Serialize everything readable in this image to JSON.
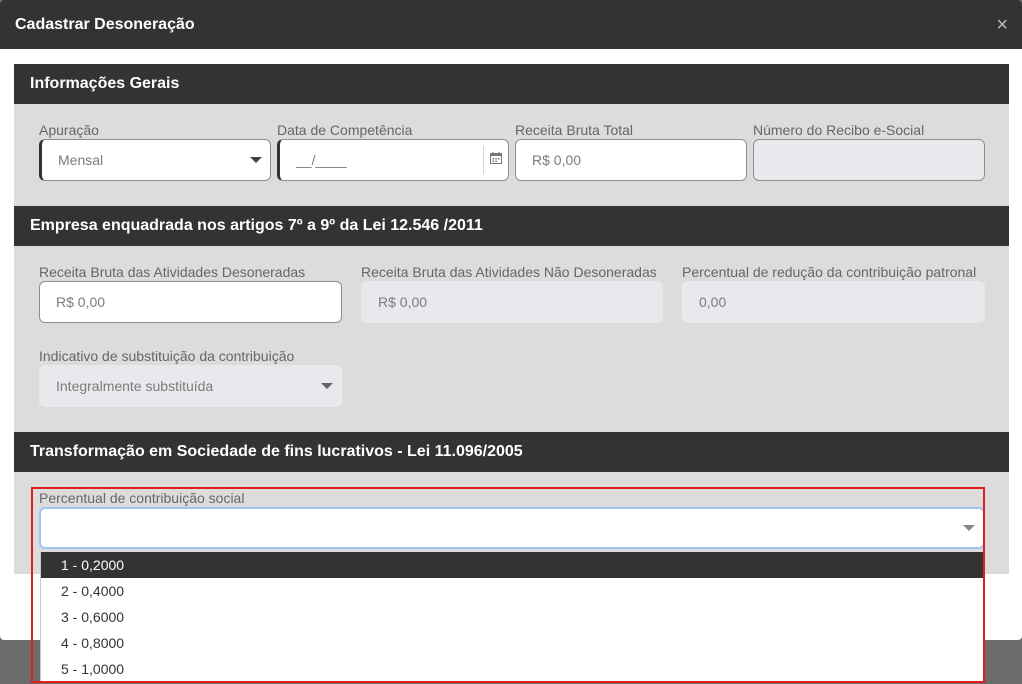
{
  "modal": {
    "title": "Cadastrar Desoneração",
    "close_label": "×"
  },
  "section1": {
    "title": "Informações Gerais",
    "apuracao": {
      "label": "Apuração",
      "value": "Mensal"
    },
    "data_competencia": {
      "label": "Data de Competência",
      "value": "__/____"
    },
    "receita_bruta_total": {
      "label": "Receita Bruta Total",
      "value": "R$ 0,00"
    },
    "numero_recibo": {
      "label": "Número do Recibo e-Social",
      "value": ""
    }
  },
  "section2": {
    "title": "Empresa enquadrada nos artigos 7º a 9º da Lei 12.546 /2011",
    "receita_desoneradas": {
      "label": "Receita Bruta das Atividades Desoneradas",
      "value": "R$ 0,00"
    },
    "receita_nao_desoneradas": {
      "label": "Receita Bruta das Atividades Não Desoneradas",
      "value": "R$ 0,00"
    },
    "percentual_reducao": {
      "label": "Percentual de redução da contribuição patronal",
      "value": "0,00"
    },
    "indicativo": {
      "label": "Indicativo de substituição da contribuição",
      "value": "Integralmente substituída"
    }
  },
  "section3": {
    "title": "Transformação em Sociedade de fins lucrativos - Lei 11.096/2005",
    "percentual_contribuicao": {
      "label": "Percentual de contribuição social",
      "value": ""
    },
    "options": [
      "1 - 0,2000",
      "2 - 0,4000",
      "3 - 0,6000",
      "4 - 0,8000",
      "5 - 1,0000"
    ],
    "highlighted_option_index": 0
  },
  "colors": {
    "header_bg": "#333333",
    "section_bg": "#dcdcdc",
    "highlight_border": "#e02020",
    "focus_border": "#9ec3ee"
  }
}
